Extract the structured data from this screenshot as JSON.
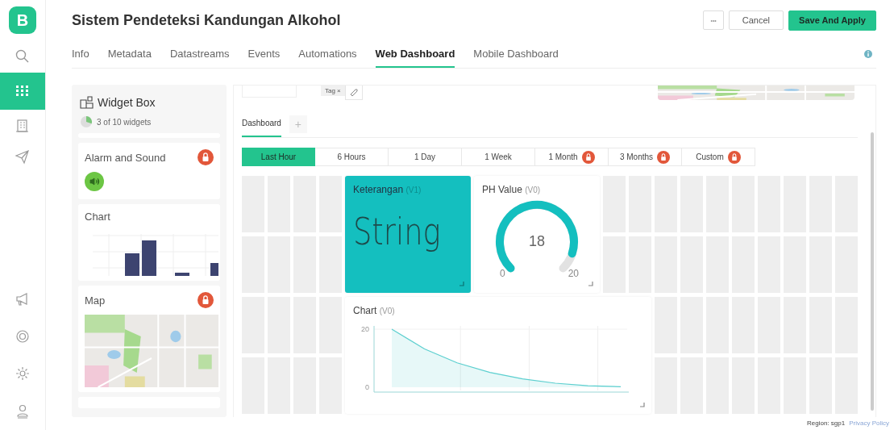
{
  "app": {
    "logo": "B"
  },
  "rail": {
    "top": [
      {
        "selected": false
      },
      {
        "selected": true
      },
      {
        "selected": false
      },
      {
        "selected": false
      }
    ],
    "bottom": [
      {
        "selected": false
      },
      {
        "selected": false
      },
      {
        "selected": false
      },
      {
        "selected": false
      }
    ]
  },
  "header": {
    "title": "Sistem Pendeteksi Kandungan Alkohol",
    "more": "•••",
    "cancel": "Cancel",
    "save": "Save And Apply"
  },
  "tabs": [
    {
      "label": "Info",
      "selected": false
    },
    {
      "label": "Metadata",
      "selected": false
    },
    {
      "label": "Datastreams",
      "selected": false
    },
    {
      "label": "Events",
      "selected": false
    },
    {
      "label": "Automations",
      "selected": false
    },
    {
      "label": "Web Dashboard",
      "selected": true
    },
    {
      "label": "Mobile Dashboard",
      "selected": false
    }
  ],
  "widget_box": {
    "title": "Widget Box",
    "usage": "3 of 10 widgets",
    "items": [
      {
        "kind": "alarm",
        "name": "Alarm and Sound",
        "locked": true
      },
      {
        "kind": "chart",
        "name": "Chart",
        "locked": false
      },
      {
        "kind": "map",
        "name": "Map",
        "locked": true
      }
    ]
  },
  "canvas": {
    "tag": "Tag ×",
    "dashboard_tabs": [
      {
        "label": "Dashboard",
        "selected": true
      }
    ],
    "add_tab": "+",
    "ranges": [
      {
        "label": "Last Hour",
        "selected": true,
        "locked": false
      },
      {
        "label": "6 Hours",
        "selected": false,
        "locked": false
      },
      {
        "label": "1 Day",
        "selected": false,
        "locked": false
      },
      {
        "label": "1 Week",
        "selected": false,
        "locked": false
      },
      {
        "label": "1 Month",
        "selected": false,
        "locked": true
      },
      {
        "label": "3 Months",
        "selected": false,
        "locked": true
      },
      {
        "label": "Custom",
        "selected": false,
        "locked": true
      }
    ],
    "widgets": [
      {
        "kind": "label",
        "title": "Keterangan",
        "pin": "(V1)",
        "value": "String"
      },
      {
        "kind": "gauge",
        "title": "PH Value",
        "pin": "(V0)",
        "value": "18",
        "min": "0",
        "max": "20"
      },
      {
        "kind": "chart",
        "title": "Chart",
        "pin": "(V0)",
        "chart_data": {
          "type": "area",
          "ylim": [
            0,
            20
          ],
          "yticks": [
            0,
            20
          ],
          "series": [
            {
              "color": "#5ccfcf",
              "values": [
                20,
                13.2,
                8.4,
                5.1,
                2.9,
                1.4,
                0.5,
                0.2
              ]
            }
          ]
        }
      }
    ]
  },
  "footer": {
    "region": "Region: sgp1",
    "privacy": "Privacy Policy"
  }
}
